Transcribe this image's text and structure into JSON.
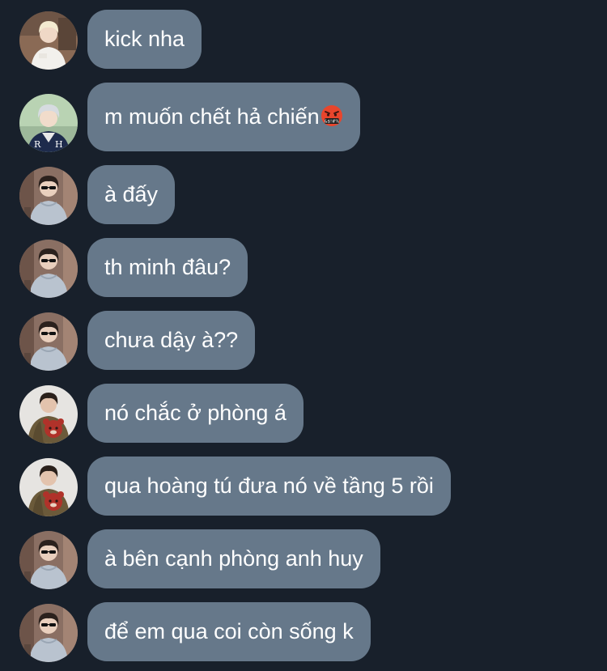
{
  "conversation": {
    "messages": [
      {
        "avatar": "blond-hair-white-shirt-avatar",
        "text": "kick nha"
      },
      {
        "avatar": "silver-hair-varsity-jacket-avatar",
        "text": "m muốn chết hả chiến",
        "emoji": "cursing-face-emoji"
      },
      {
        "avatar": "sunglasses-grey-hoodie-avatar",
        "text": "à đấy"
      },
      {
        "avatar": "sunglasses-grey-hoodie-avatar",
        "text": "th minh đâu?"
      },
      {
        "avatar": "sunglasses-grey-hoodie-avatar",
        "text": "chưa dậy à??"
      },
      {
        "avatar": "olive-jacket-bear-avatar",
        "text": "nó chắc ở phòng á"
      },
      {
        "avatar": "olive-jacket-bear-avatar",
        "text": "qua hoàng tú đưa nó về tầng 5 rồi"
      },
      {
        "avatar": "sunglasses-grey-hoodie-avatar",
        "text": "à bên cạnh phòng anh huy"
      },
      {
        "avatar": "sunglasses-grey-hoodie-avatar",
        "text": "để em qua coi còn sống k"
      }
    ]
  },
  "colors": {
    "background": "#18202b",
    "bubble": "#66788a",
    "text": "#ffffff"
  }
}
